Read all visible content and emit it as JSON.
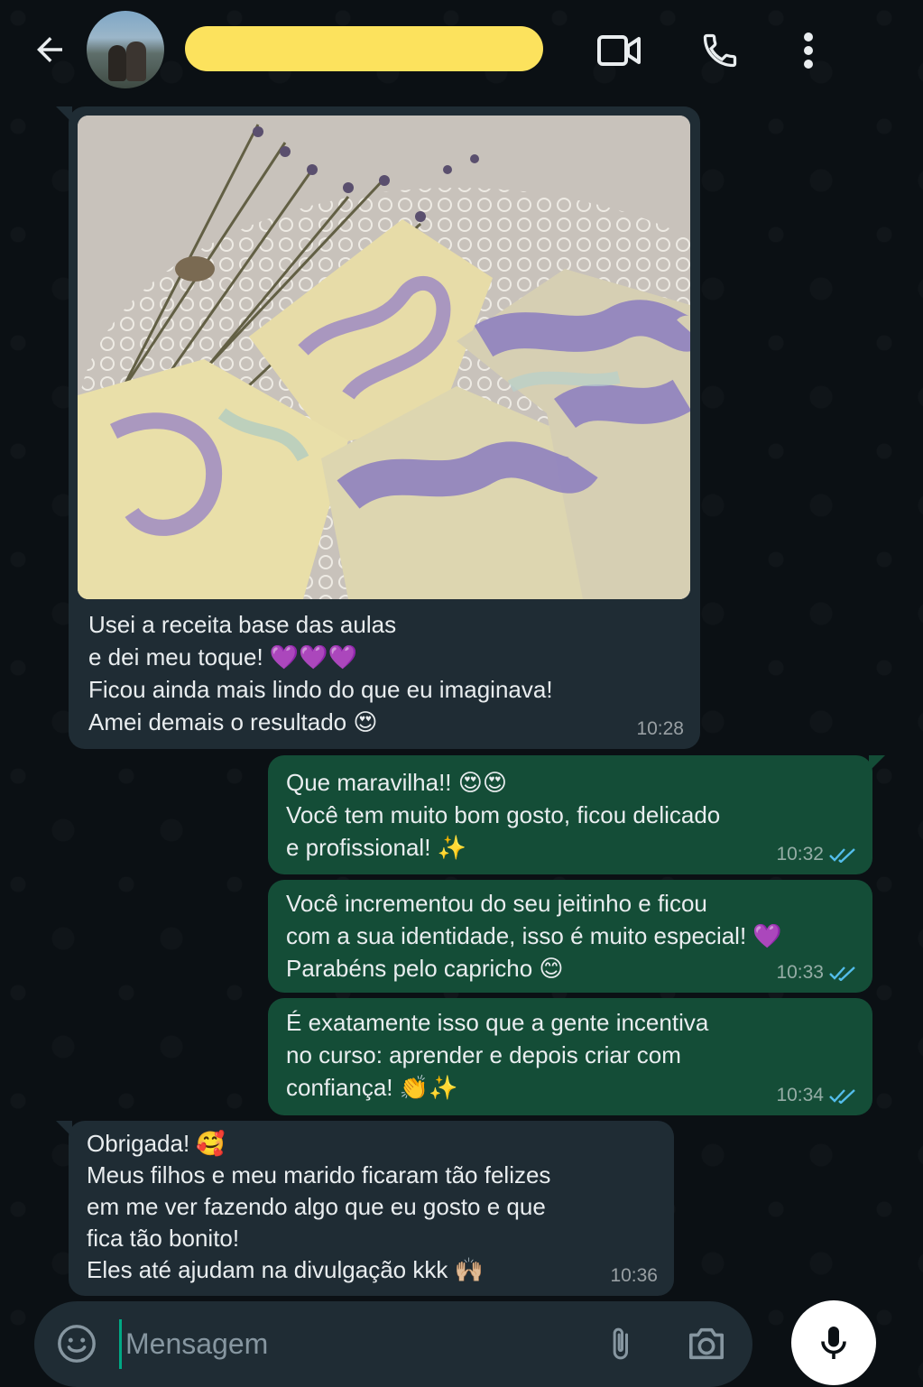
{
  "header": {
    "contact_name": "",
    "name_highlight_color": "#fce25d",
    "icons": [
      "back-arrow-icon",
      "video-call-icon",
      "phone-icon",
      "more-vert-icon"
    ]
  },
  "messages": [
    {
      "direction": "incoming",
      "has_image": true,
      "image_description_icon": "photo",
      "text": "Usei a receita base das aulas\ne dei meu toque! 💜💜💜\nFicou ainda mais lindo do que eu imaginava!\nAmei demais o resultado 😍",
      "time": "10:28"
    },
    {
      "direction": "outgoing",
      "text": "Que maravilha!! 😍😍\nVocê tem muito bom gosto, ficou delicado\ne profissional! ✨",
      "time": "10:32",
      "status": "read"
    },
    {
      "direction": "outgoing",
      "text": "Você incrementou do seu jeitinho e ficou\ncom a sua identidade, isso é muito especial! 💜\nParabéns pelo capricho 😊",
      "time": "10:33",
      "status": "read"
    },
    {
      "direction": "outgoing",
      "text": "É exatamente isso que a gente incentiva\nno curso: aprender e depois criar com\nconfiança! 👏✨",
      "time": "10:34",
      "status": "read"
    },
    {
      "direction": "incoming",
      "text": "Obrigada! 🥰\nMeus filhos e meu marido ficaram tão felizes\nem me ver fazendo algo que eu gosto e que\nfica tão bonito!\nEles até ajudam na divulgação kkk 🙌🏼",
      "time": "10:36"
    }
  ],
  "composer": {
    "placeholder": "Mensagem",
    "value": ""
  },
  "colors": {
    "background": "#0b1014",
    "incoming_bubble": "#1f2c34",
    "outgoing_bubble": "#144d37",
    "read_ticks": "#53bdeb",
    "accent": "#00a884"
  }
}
